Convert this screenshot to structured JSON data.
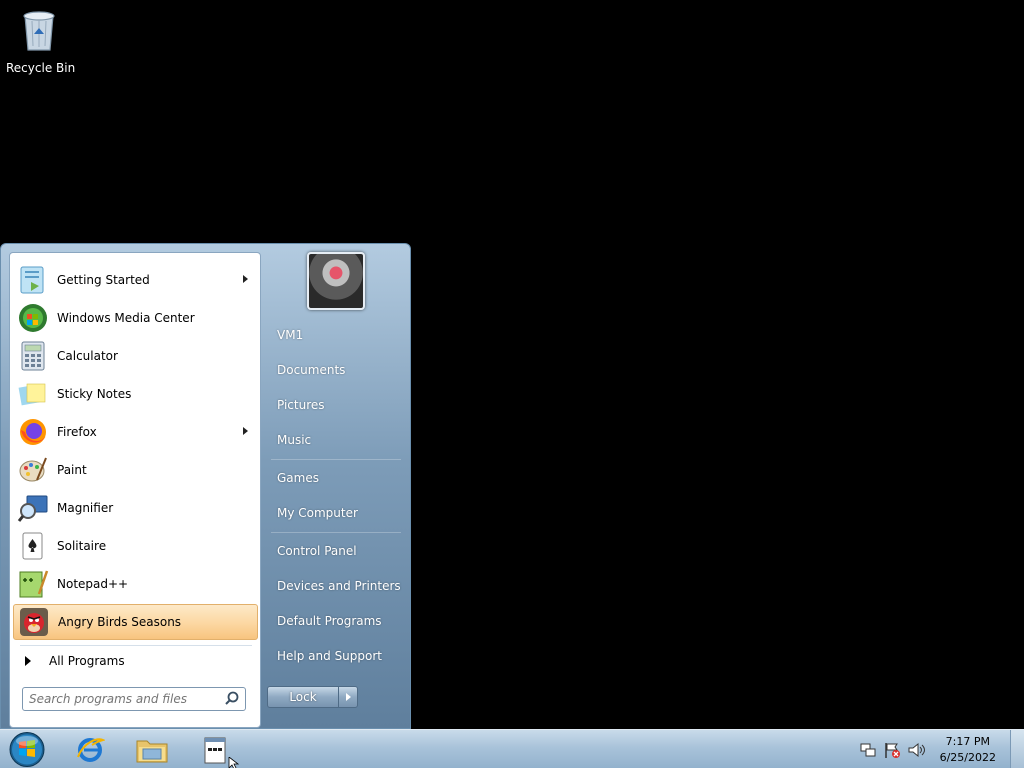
{
  "desktop": {
    "recycle_bin_label": "Recycle Bin"
  },
  "start_menu": {
    "programs": [
      {
        "label": "Getting Started",
        "icon": "getting-started-icon",
        "submenu": true
      },
      {
        "label": "Windows Media Center",
        "icon": "media-center-icon",
        "submenu": false
      },
      {
        "label": "Calculator",
        "icon": "calculator-icon",
        "submenu": false
      },
      {
        "label": "Sticky Notes",
        "icon": "sticky-notes-icon",
        "submenu": false
      },
      {
        "label": "Firefox",
        "icon": "firefox-icon",
        "submenu": true
      },
      {
        "label": "Paint",
        "icon": "paint-icon",
        "submenu": false
      },
      {
        "label": "Magnifier",
        "icon": "magnifier-icon",
        "submenu": false
      },
      {
        "label": "Solitaire",
        "icon": "solitaire-icon",
        "submenu": false
      },
      {
        "label": "Notepad++",
        "icon": "notepad-plus-plus-icon",
        "submenu": false
      },
      {
        "label": "Angry Birds Seasons",
        "icon": "angry-birds-icon",
        "submenu": false,
        "highlighted": true
      }
    ],
    "all_programs_label": "All Programs",
    "search": {
      "placeholder": "Search programs and files",
      "value": ""
    },
    "right_items": [
      {
        "label": "VM1"
      },
      {
        "label": "Documents"
      },
      {
        "label": "Pictures"
      },
      {
        "label": "Music"
      },
      {
        "label": "Games"
      },
      {
        "label": "My Computer"
      },
      {
        "label": "Control Panel"
      },
      {
        "label": "Devices and Printers"
      },
      {
        "label": "Default Programs"
      },
      {
        "label": "Help and Support"
      }
    ],
    "lock_label": "Lock"
  },
  "taskbar": {
    "pinned": [
      "internet-explorer-icon",
      "windows-explorer-icon",
      "notepad-window-icon"
    ],
    "clock_time": "7:17 PM",
    "clock_date": "6/25/2022"
  }
}
